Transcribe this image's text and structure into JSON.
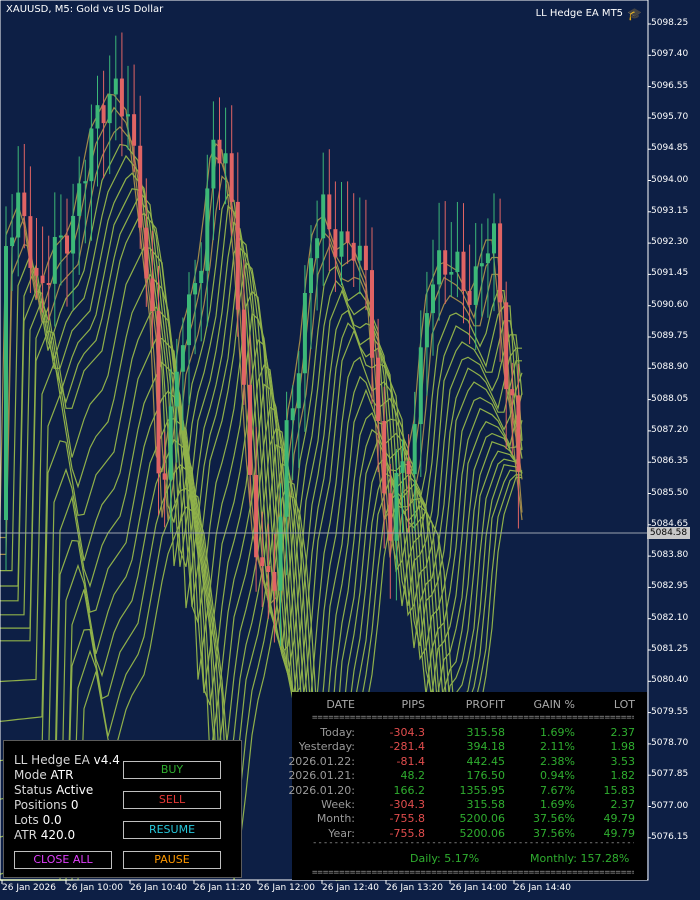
{
  "chart": {
    "symbol": "XAUUSD, M5:  Gold vs US Dollar",
    "ea_name": "LL Hedge EA MT5",
    "cap_icon": "graduation-cap-icon",
    "price_axis": [
      "5098.25",
      "5097.40",
      "5096.55",
      "5095.70",
      "5094.85",
      "5094.00",
      "5093.15",
      "5092.30",
      "5091.45",
      "5090.60",
      "5089.75",
      "5088.90",
      "5088.05",
      "5087.20",
      "5086.35",
      "5085.50",
      "5084.65",
      "5083.80",
      "5082.95",
      "5082.10",
      "5081.25",
      "5080.40",
      "5079.55",
      "5078.70",
      "5077.85",
      "5077.00",
      "5076.15"
    ],
    "current_price": "5084.58",
    "time_axis": [
      "26 Jan 2026",
      "26 Jan 10:00",
      "26 Jan 10:40",
      "26 Jan 11:20",
      "26 Jan 12:00",
      "26 Jan 12:40",
      "26 Jan 13:20",
      "26 Jan 14:00",
      "26 Jan 14:40"
    ],
    "colors": {
      "background": "#0d1f45",
      "bull": "#3cb878",
      "bear": "#e06464",
      "ribbon": "#8fb04a",
      "axis": "#ffffff"
    }
  },
  "stats": {
    "headers": [
      "DATE",
      "PIPS",
      "PROFIT",
      "GAIN %",
      "LOT"
    ],
    "separator": "========================================================================",
    "rows": [
      {
        "date": "Today:",
        "pips": "-304.3",
        "profit": "315.58",
        "gain": "1.69%",
        "lot": "2.37"
      },
      {
        "date": "Yesterday:",
        "pips": "-281.4",
        "profit": "394.18",
        "gain": "2.11%",
        "lot": "1.98"
      },
      {
        "date": "2026.01.22:",
        "pips": "-81.4",
        "profit": "442.45",
        "gain": "2.38%",
        "lot": "3.53"
      },
      {
        "date": "2026.01.21:",
        "pips": "48.2",
        "profit": "176.50",
        "gain": "0.94%",
        "lot": "1.82"
      },
      {
        "date": "2026.01.20:",
        "pips": "166.2",
        "profit": "1355.95",
        "gain": "7.67%",
        "lot": "15.83"
      },
      {
        "date": "Week:",
        "pips": "-304.3",
        "profit": "315.58",
        "gain": "1.69%",
        "lot": "2.37"
      },
      {
        "date": "Month:",
        "pips": "-755.8",
        "profit": "5200.06",
        "gain": "37.56%",
        "lot": "49.79"
      },
      {
        "date": "Year:",
        "pips": "-755.8",
        "profit": "5200.06",
        "gain": "37.56%",
        "lot": "49.79"
      }
    ],
    "dash_line": "----------------------------------------------------------------------------------------",
    "daily": "Daily: 5.17%",
    "monthly": "Monthly: 157.28%"
  },
  "panel": {
    "title": "LL Hedge EA",
    "version": "v4.4",
    "mode_label": "Mode",
    "mode_value": "ATR",
    "status_label": "Status",
    "status_value": "Active",
    "positions_label": "Positions",
    "positions_value": "0",
    "lots_label": "Lots",
    "lots_value": "0.0",
    "atr_label": "ATR",
    "atr_value": "420.0",
    "buttons": {
      "buy": {
        "label": "BUY",
        "color": "#2fae2f"
      },
      "sell": {
        "label": "SELL",
        "color": "#e53935"
      },
      "resume": {
        "label": "RESUME",
        "color": "#26c6da"
      },
      "close_all": {
        "label": "CLOSE ALL",
        "color": "#e040fb"
      },
      "pause": {
        "label": "PAUSE",
        "color": "#ff9800"
      }
    }
  }
}
